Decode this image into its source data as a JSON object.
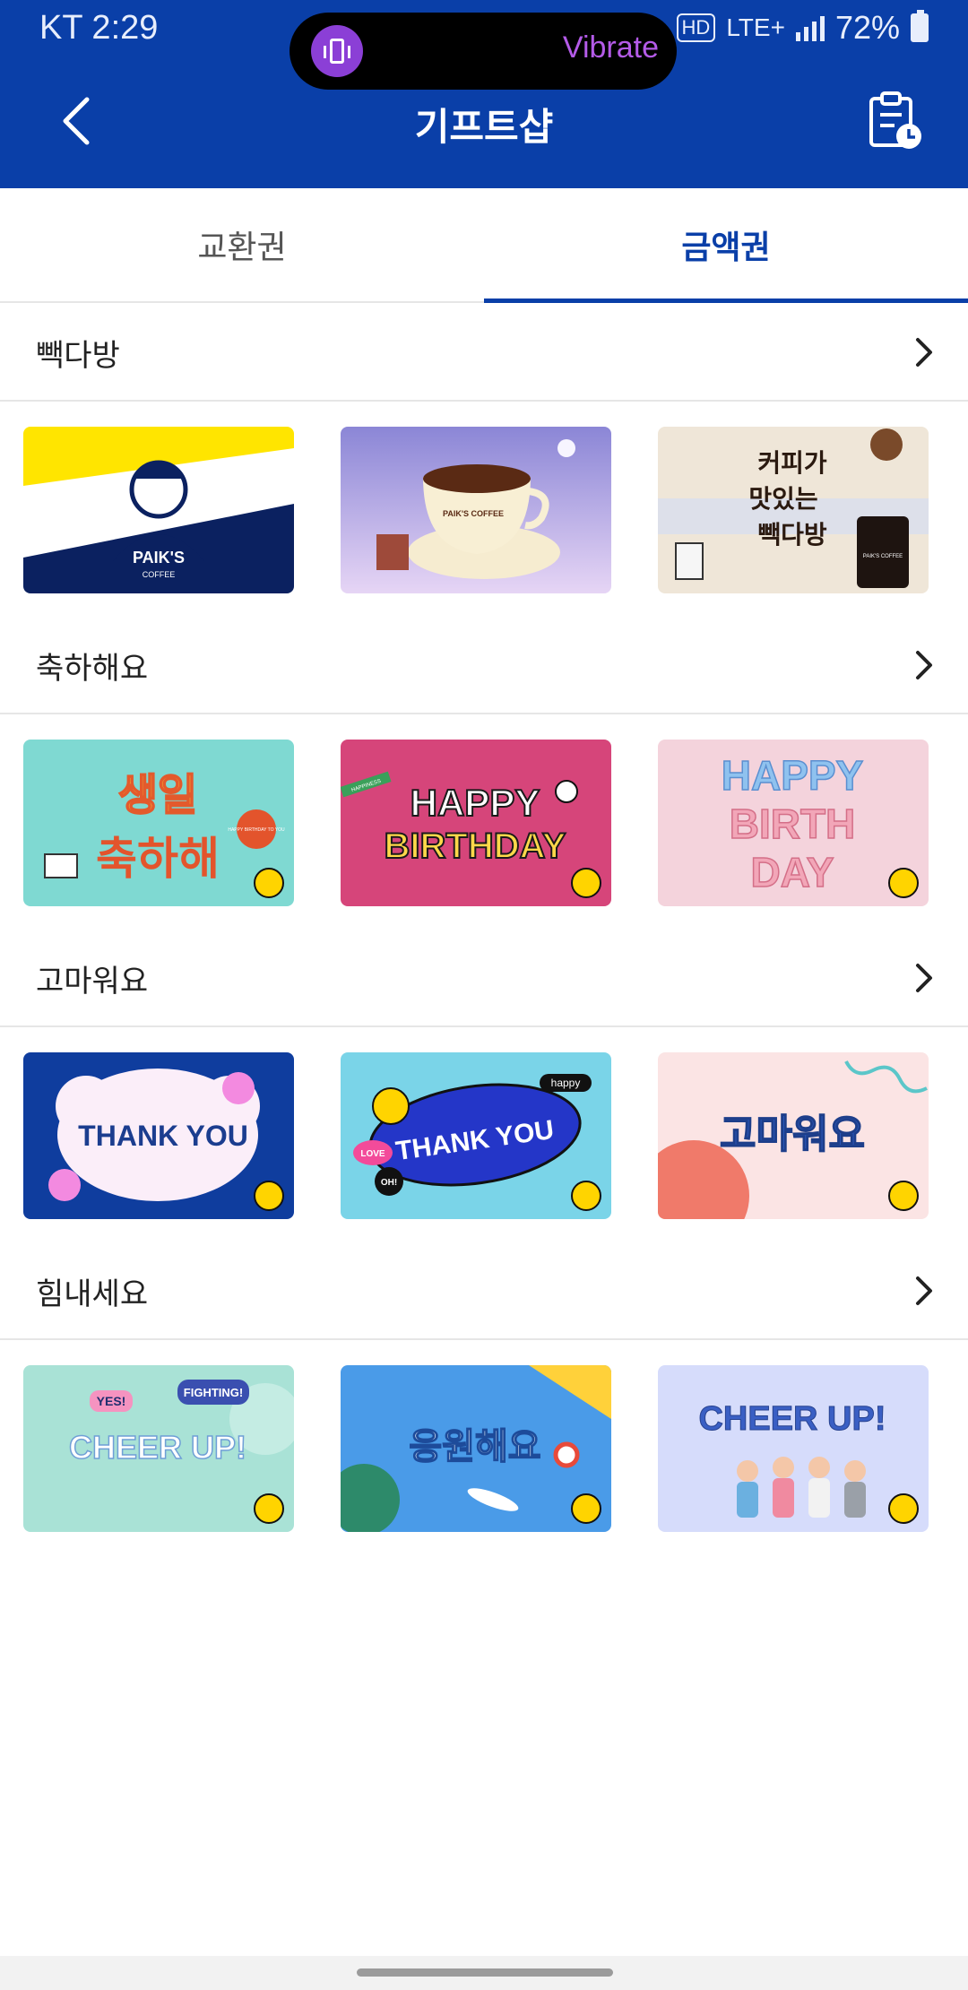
{
  "status_bar": {
    "time": "KT 2:29",
    "hd": "HD",
    "network": "LTE+",
    "battery": "72%"
  },
  "notification_pill": {
    "label": "Vibrate"
  },
  "header": {
    "title": "기프트샵"
  },
  "tabs": [
    {
      "label": "교환권",
      "active": false
    },
    {
      "label": "금액권",
      "active": true
    }
  ],
  "sections": [
    {
      "title": "빽다방",
      "cards": [
        {
          "icon": "paiks-logo-card",
          "lines": [
            "PAIK'S",
            "COFFEE"
          ]
        },
        {
          "icon": "coffee-cup-card",
          "lines": [
            "PAIK'S COFFEE"
          ]
        },
        {
          "icon": "coffee-tasty-card",
          "lines": [
            "커피가",
            "맛있는",
            "빽다방",
            "PAIK'S COFFEE"
          ]
        }
      ]
    },
    {
      "title": "축하해요",
      "cards": [
        {
          "icon": "birthday-korean-card",
          "lines": [
            "생일",
            "축하해",
            "HAPPY BIRTHDAY TO YOU"
          ]
        },
        {
          "icon": "happy-birthday-pink-card",
          "lines": [
            "HAPPY",
            "BIRTHDAY",
            "HAPPINESS"
          ]
        },
        {
          "icon": "happy-birthday-balloon-card",
          "lines": [
            "HAPPY",
            "BIRTH",
            "DAY"
          ]
        }
      ]
    },
    {
      "title": "고마워요",
      "cards": [
        {
          "icon": "thank-you-cloud-card",
          "lines": [
            "THANK YOU"
          ]
        },
        {
          "icon": "thank-you-sticker-card",
          "lines": [
            "THANK YOU",
            "happy",
            "LOVE",
            "OH!"
          ]
        },
        {
          "icon": "thank-you-korean-card",
          "lines": [
            "고마워요"
          ]
        }
      ]
    },
    {
      "title": "힘내세요",
      "cards": [
        {
          "icon": "cheer-up-mint-card",
          "lines": [
            "CHEER UP!",
            "YES!",
            "FIGHTING!"
          ]
        },
        {
          "icon": "cheer-korean-card",
          "lines": [
            "응원해요"
          ]
        },
        {
          "icon": "cheer-up-people-card",
          "lines": [
            "CHEER UP!"
          ]
        }
      ]
    }
  ],
  "colors": {
    "brand_blue": "#0a3fa8",
    "active_tab": "#0a3fa8",
    "pill_accent": "#8b3fd6"
  }
}
